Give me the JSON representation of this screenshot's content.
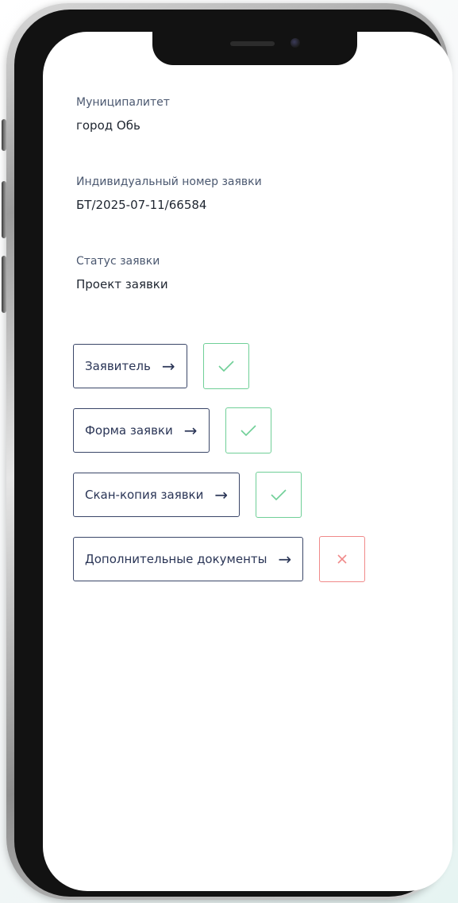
{
  "application": {
    "municipality": {
      "label": "Муниципалитет",
      "value": "город Обь"
    },
    "number": {
      "label": "Индивидуальный номер заявки",
      "value": "БТ/2025-07-11/66584"
    },
    "status": {
      "label": "Статус заявки",
      "value": "Проект заявки"
    }
  },
  "sections": [
    {
      "label": "Заявитель",
      "icon": "arrow-right-icon",
      "state": "complete",
      "state_icon": "check-icon"
    },
    {
      "label": "Форма заявки",
      "icon": "arrow-right-icon",
      "state": "complete",
      "state_icon": "check-icon"
    },
    {
      "label": "Скан-копия заявки",
      "icon": "arrow-right-icon",
      "state": "complete",
      "state_icon": "check-icon"
    },
    {
      "label": "Дополнительные документы",
      "icon": "arrow-right-icon",
      "state": "incomplete",
      "state_icon": "cross-icon"
    }
  ],
  "colors": {
    "button_border": "#3a4668",
    "complete": "#6fcf97",
    "incomplete": "#f08a8a",
    "label_text": "#4b5870",
    "value_text": "#1e2530"
  }
}
